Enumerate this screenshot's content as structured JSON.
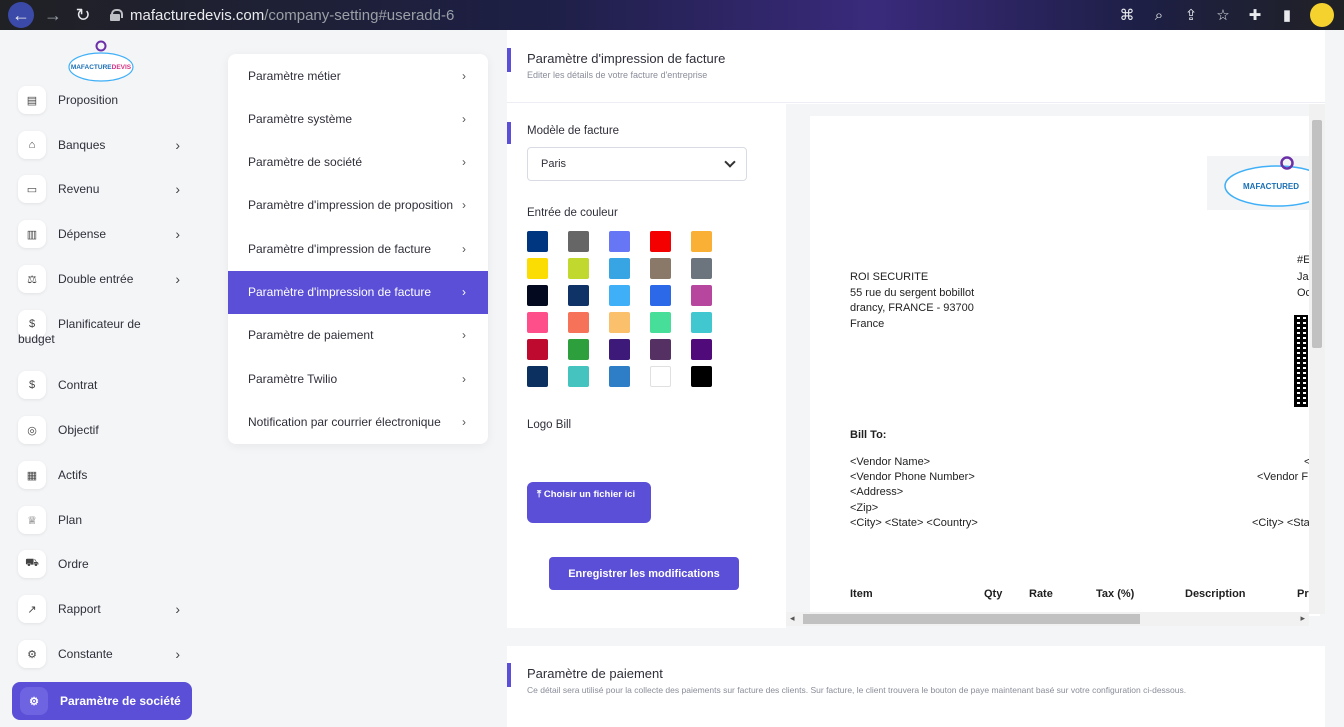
{
  "browser": {
    "url_host": "mafacturedevis.com",
    "url_path": "/company-setting#useradd-6"
  },
  "sidebar": {
    "logo_text": "MAFACTUREDEVIS",
    "items": [
      {
        "label": "Proposition",
        "icon": "document-icon",
        "chevron": false
      },
      {
        "label": "Banques",
        "icon": "bank-icon",
        "chevron": true
      },
      {
        "label": "Revenu",
        "icon": "file-icon",
        "chevron": true
      },
      {
        "label": "Dépense",
        "icon": "receipt-icon",
        "chevron": true
      },
      {
        "label": "Double entrée",
        "icon": "balance-icon",
        "chevron": true
      },
      {
        "label": "Planificateur de",
        "label2": "budget",
        "icon": "money-icon",
        "chevron": false
      },
      {
        "label": "Contrat",
        "icon": "money-icon",
        "chevron": false
      },
      {
        "label": "Objectif",
        "icon": "target-icon",
        "chevron": false
      },
      {
        "label": "Actifs",
        "icon": "calculator-icon",
        "chevron": false
      },
      {
        "label": "Plan",
        "icon": "trophy-icon",
        "chevron": false
      },
      {
        "label": "Ordre",
        "icon": "cart-icon",
        "chevron": false
      },
      {
        "label": "Rapport",
        "icon": "chart-icon",
        "chevron": true
      },
      {
        "label": "Constante",
        "icon": "settings-icon",
        "chevron": true
      }
    ],
    "active_label": "Paramètre de société"
  },
  "submenu": {
    "items": [
      "Paramètre métier",
      "Paramètre système",
      "Paramètre de société",
      "Paramètre d'impression de proposition",
      "Paramètre d'impression de facture",
      "Paramètre d'impression de facture",
      "Paramètre de paiement",
      "Paramètre Twilio",
      "Notification par courrier électronique"
    ],
    "active_index": 5
  },
  "invoice_settings": {
    "title": "Paramètre d'impression de facture",
    "subtitle": "Editer les détails de votre facture d'entreprise",
    "template_label": "Modèle de facture",
    "template_value": "Paris",
    "color_label": "Entrée de couleur",
    "colors": [
      "#003580",
      "#666666",
      "#6676f5",
      "#f50000",
      "#f9b034",
      "#fbdd03",
      "#c1d82f",
      "#37a4e4",
      "#8a7969",
      "#6c757d",
      "#030a1f",
      "#0f3366",
      "#3fb0f7",
      "#2c69e8",
      "#b7479e",
      "#ff4f8b",
      "#f6735a",
      "#fac06b",
      "#46de98",
      "#40c7d0",
      "#be0a2f",
      "#2d9f3d",
      "#3d1a7a",
      "#553163",
      "#500a7a",
      "#0c3161",
      "#45c3bf",
      "#2d7ec6",
      "#ffffff",
      "#000000"
    ],
    "logo_label": "Logo Bill",
    "upload_label": "Choisir un fichier ici",
    "save_label": "Enregistrer les modifications"
  },
  "preview": {
    "logo_text": "MAFACTURED",
    "company_name": "ROI SECURITE",
    "address_line1": "55 rue du sergent bobillot",
    "address_line2": "drancy, FRANCE - 93700",
    "country": "France",
    "right_top1": "#E",
    "right_top2": "Ja",
    "right_top3": "Oc",
    "bill_to": "Bill To:",
    "vendor_name": "<Vendor Name>",
    "vendor_phone": "<Vendor Phone Number>",
    "address": "<Address>",
    "zip": "<Zip>",
    "city_line": "<City> <State> <Country>",
    "right_vendor1": "<",
    "right_vendor2": "<Vendor F",
    "right_city": "<City> <Sta",
    "table_headers": [
      "Item",
      "Qty",
      "Rate",
      "Tax (%)",
      "Description",
      "Pr"
    ]
  },
  "payment_settings": {
    "title": "Paramètre de paiement",
    "subtitle": "Ce détail sera utilisé pour la collecte des paiements sur facture des clients. Sur facture, le client trouvera le bouton de paye maintenant basé sur votre configuration ci-dessous."
  }
}
